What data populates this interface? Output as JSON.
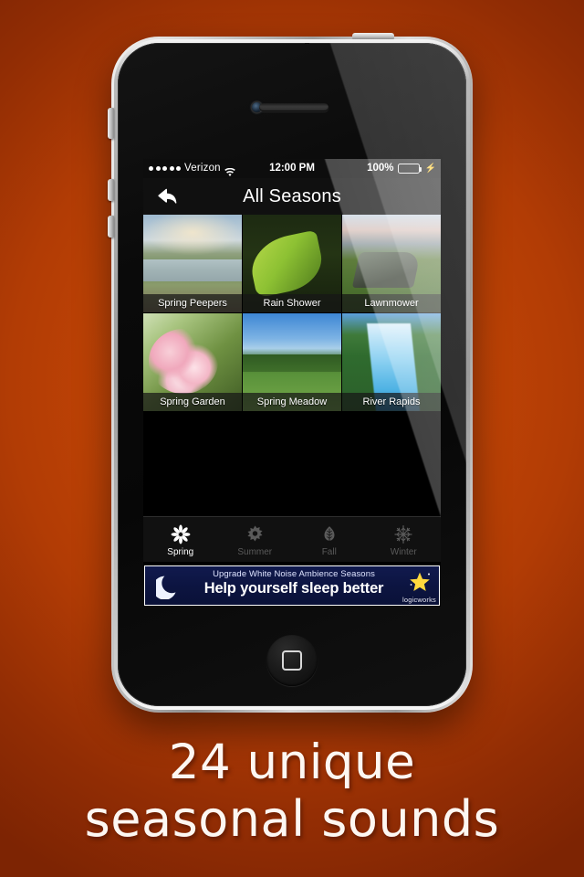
{
  "promo": {
    "line1": "24 unique",
    "line2": "seasonal sounds",
    "background_color": "#c44606"
  },
  "device": {
    "name": "iphone-4",
    "frame_color": "#0a0a0a",
    "bezel_color": "#cfcfcf"
  },
  "status_bar": {
    "signal_dots": 5,
    "carrier": "Verizon",
    "wifi_icon": "wifi-icon",
    "time": "12:00 PM",
    "battery_percent": "100%",
    "battery_level": 100,
    "battery_color": "#6fdc7a",
    "charging_icon": "lightning-bolt-icon"
  },
  "nav_bar": {
    "back_icon": "back-arrow-icon",
    "title": "All Seasons"
  },
  "grid": {
    "tiles": [
      {
        "label": "Spring Peepers",
        "art": "art-peepers"
      },
      {
        "label": "Rain Shower",
        "art": "art-rain"
      },
      {
        "label": "Lawnmower",
        "art": "art-mower"
      },
      {
        "label": "Spring Garden",
        "art": "art-garden"
      },
      {
        "label": "Spring Meadow",
        "art": "art-meadow"
      },
      {
        "label": "River Rapids",
        "art": "art-rapids"
      }
    ]
  },
  "tab_bar": {
    "tabs": [
      {
        "label": "Spring",
        "icon": "flower-icon",
        "active": true
      },
      {
        "label": "Summer",
        "icon": "sun-icon",
        "active": false
      },
      {
        "label": "Fall",
        "icon": "leaf-icon",
        "active": false
      },
      {
        "label": "Winter",
        "icon": "snowflake-icon",
        "active": false
      }
    ],
    "active_color": "#ffffff",
    "inactive_color": "#5a5a5a"
  },
  "ad_banner": {
    "headline": "Upgrade White Noise Ambience Seasons",
    "subhead": "Help yourself sleep better",
    "brand": "logicworks",
    "moon_icon": "crescent-moon-icon",
    "star_icon": "star-icon",
    "background_color": "#0c1440"
  }
}
